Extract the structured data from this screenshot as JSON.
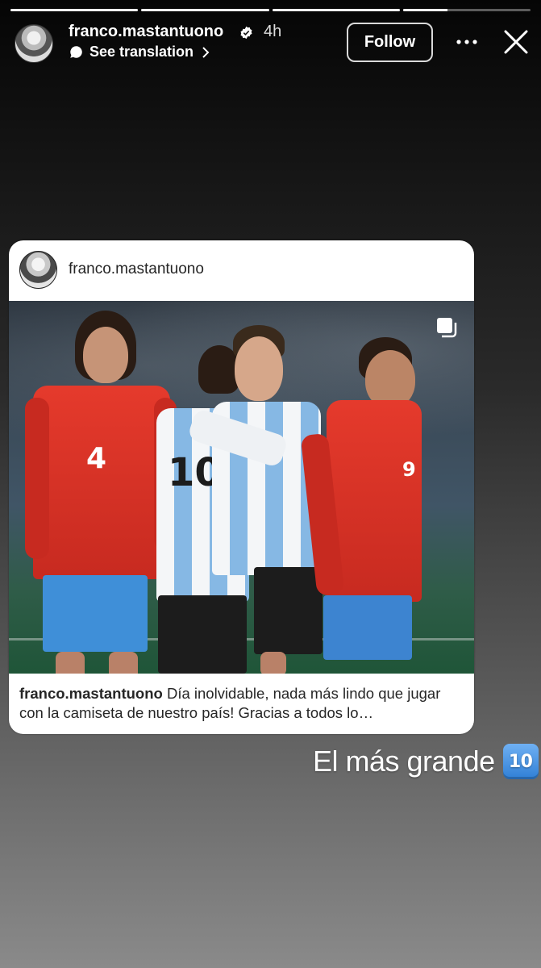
{
  "story": {
    "progress": [
      1,
      1,
      1,
      0.35
    ],
    "header": {
      "username": "franco.mastantuono",
      "time": "4h",
      "translation": "See translation",
      "follow_label": "Follow",
      "icons": [
        "verified-badge-icon",
        "translate-bubble-icon",
        "chevron-right-icon",
        "more-options-icon",
        "close-icon"
      ]
    },
    "shared_post": {
      "username": "franco.mastantuono",
      "caption_user": "franco.mastantuono",
      "caption_text": "Día inolvidable, nada más lindo que jugar con la camiseta de nuestro país! Gracias a todos lo…",
      "image_icon": "carousel-multi-icon",
      "jersey_numbers": [
        "4",
        "10",
        "9"
      ]
    },
    "overlay_text": "El más grande",
    "overlay_emoji": "10"
  }
}
